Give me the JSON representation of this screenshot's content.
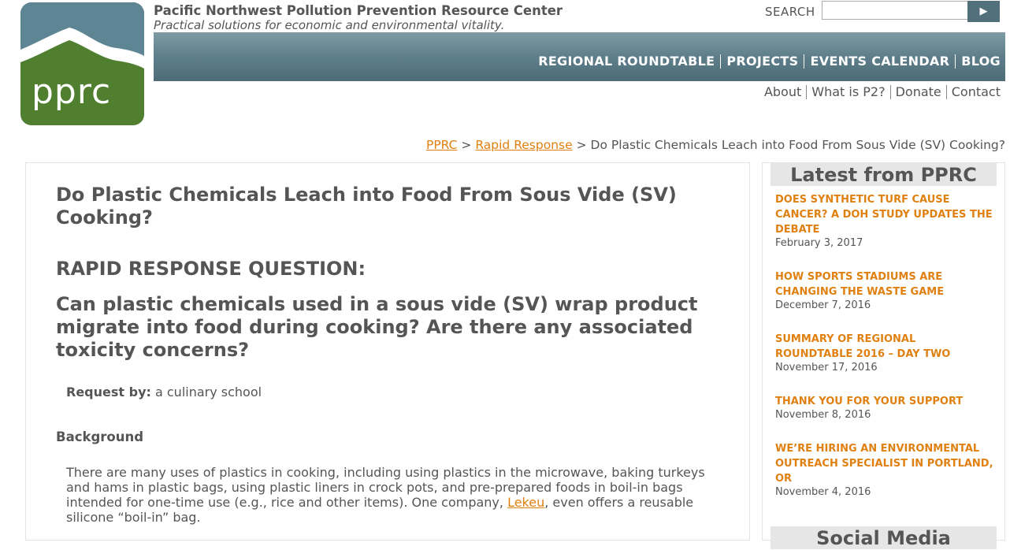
{
  "site": {
    "logo_text": "pprc",
    "name": "Pacific Northwest Pollution Prevention Resource Center",
    "tagline": "Practical solutions for economic and environmental vitality."
  },
  "search": {
    "label": "SEARCH",
    "value": "",
    "button_icon": "play-arrow-icon",
    "button_glyph": "▶"
  },
  "main_nav": [
    {
      "label": "REGIONAL ROUNDTABLE"
    },
    {
      "label": "PROJECTS"
    },
    {
      "label": "EVENTS CALENDAR"
    },
    {
      "label": "BLOG"
    }
  ],
  "sub_nav": [
    {
      "label": "About"
    },
    {
      "label": "What is P2?"
    },
    {
      "label": "Donate"
    },
    {
      "label": "Contact"
    }
  ],
  "breadcrumb": {
    "home": "PPRC",
    "section": "Rapid Response",
    "separator": ">",
    "current": "Do Plastic Chemicals Leach into Food From Sous Vide (SV) Cooking?"
  },
  "article": {
    "title": "Do Plastic Chemicals Leach into Food From Sous Vide (SV) Cooking?",
    "rr_heading": "RAPID RESPONSE QUESTION:",
    "question": "Can plastic chemicals used in a sous vide (SV) wrap product migrate into food during cooking? Are there any associated toxicity concerns?",
    "request_label": "Request by:",
    "request_value": "a culinary school",
    "background_heading": "Background",
    "background_text_before": "There are many uses of plastics in cooking, including using plastics in the microwave, baking turkeys and hams in plastic bags, using plastic liners in crock pots, and pre-prepared foods in boil-in bags intended for one-time use (e.g., rice and other items). One company, ",
    "background_link": "Lekeu",
    "background_text_after": ", even offers a reusable silicone “boil-in” bag."
  },
  "sidebar": {
    "title": "Latest from PPRC",
    "items": [
      {
        "title": "DOES SYNTHETIC TURF CAUSE CANCER? A DOH STUDY UPDATES THE DEBATE",
        "date": "February 3, 2017"
      },
      {
        "title": "HOW SPORTS STADIUMS ARE CHANGING THE WASTE GAME",
        "date": "December 7, 2016"
      },
      {
        "title": "SUMMARY OF REGIONAL ROUNDTABLE 2016 – DAY TWO",
        "date": "November 17, 2016"
      },
      {
        "title": "THANK YOU FOR YOUR SUPPORT",
        "date": "November 8, 2016"
      },
      {
        "title": "WE’RE HIRING AN ENVIRONMENTAL OUTREACH SPECIALIST IN PORTLAND, OR",
        "date": "November 4, 2016"
      }
    ],
    "next_title": "Social Media"
  },
  "colors": {
    "link_orange": "#e08010",
    "nav_bar": "#5d7e8a",
    "logo_green": "#4f7f2f",
    "text_gray": "#555555"
  }
}
